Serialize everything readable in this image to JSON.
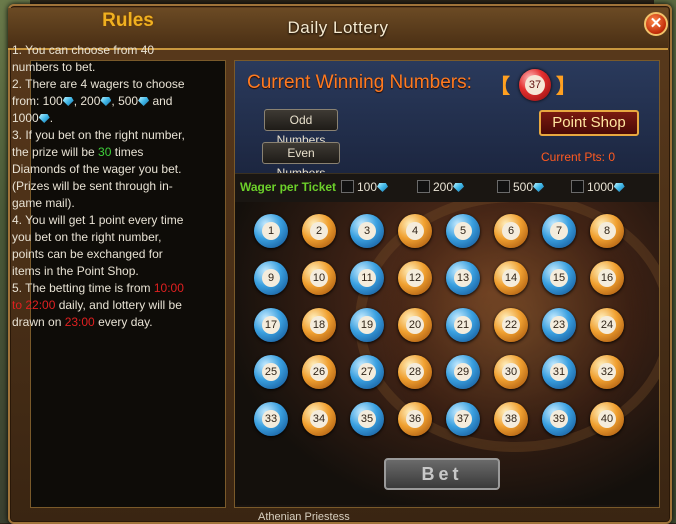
{
  "window": {
    "title": "Daily Lottery",
    "close_icon": "close-icon"
  },
  "rules": {
    "title": "Rules",
    "line1": "1. You can choose from 40 numbers to bet.",
    "line2a": "2. There are 4 wagers to choose from: 100",
    "line2b": ", 200",
    "line2c": ", 500",
    "line2d": " and 1000",
    "line2e": ".",
    "line3a": "3. If you bet on the right number, the prize will be ",
    "line3_mult": "30",
    "line3b": " times  Diamonds of the wager you bet. (Prizes will be sent through in-game mail).",
    "line4": "4. You will get 1 point every time you bet on the right number, points can be exchanged for items in the Point Shop.",
    "line5a": "5. The betting time is from ",
    "line5_time": "10:00 to 22:00",
    "line5b": " daily, and lottery will be drawn on ",
    "line5_draw": "23:00",
    "line5c": " every day."
  },
  "main": {
    "winning_label": "Current Winning Numbers:",
    "bracket_open": "【",
    "bracket_close": "】",
    "winning_number": "37",
    "odd_button": "Odd Numbers",
    "even_button": "Even Numbers",
    "point_shop_button": "Point Shop",
    "current_pts": "Current Pts: 0",
    "wager_label": "Wager per Ticket",
    "wagers": [
      "100",
      "200",
      "500",
      "1000"
    ],
    "bet_button": "Bet"
  },
  "numbers": [
    "1",
    "2",
    "3",
    "4",
    "5",
    "6",
    "7",
    "8",
    "9",
    "10",
    "11",
    "12",
    "13",
    "14",
    "15",
    "16",
    "17",
    "18",
    "19",
    "20",
    "21",
    "22",
    "23",
    "24",
    "25",
    "26",
    "27",
    "28",
    "29",
    "30",
    "31",
    "32",
    "33",
    "34",
    "35",
    "36",
    "37",
    "38",
    "39",
    "40"
  ],
  "footer": {
    "text": "Athenian Priestess"
  },
  "colors": {
    "blue_ball": "#3aa0e0",
    "orange_ball": "#f0a030",
    "accent": "#ff7a20"
  }
}
